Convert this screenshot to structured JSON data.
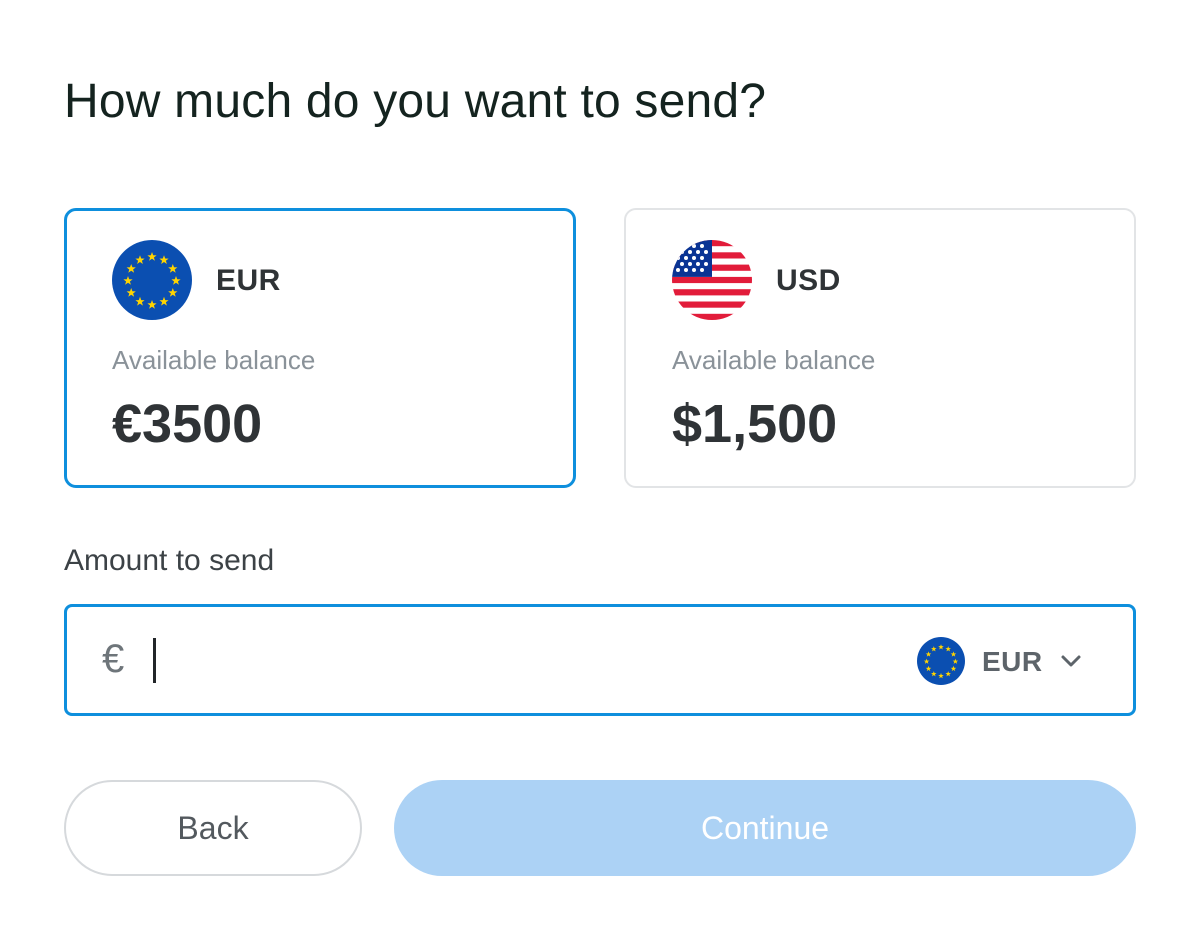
{
  "title": "How much do you want to send?",
  "accounts": [
    {
      "code": "EUR",
      "balance_label": "Available balance",
      "balance": "€3500",
      "selected": true,
      "flag_icon": "eu-flag-icon"
    },
    {
      "code": "USD",
      "balance_label": "Available balance",
      "balance": "$1,500",
      "selected": false,
      "flag_icon": "us-flag-icon"
    }
  ],
  "amount": {
    "label": "Amount to send",
    "currency_symbol": "€",
    "value": "",
    "currency_code": "EUR",
    "currency_flag_icon": "eu-flag-icon",
    "dropdown_icon": "chevron-down-icon"
  },
  "buttons": {
    "back": "Back",
    "continue": "Continue"
  },
  "colors": {
    "accent": "#0e8fdd",
    "continue_disabled": "#acd2f5",
    "eu_blue": "#0b4fb1",
    "eu_star": "#ffd400",
    "us_red": "#e21c3a",
    "us_blue": "#0a3494"
  }
}
